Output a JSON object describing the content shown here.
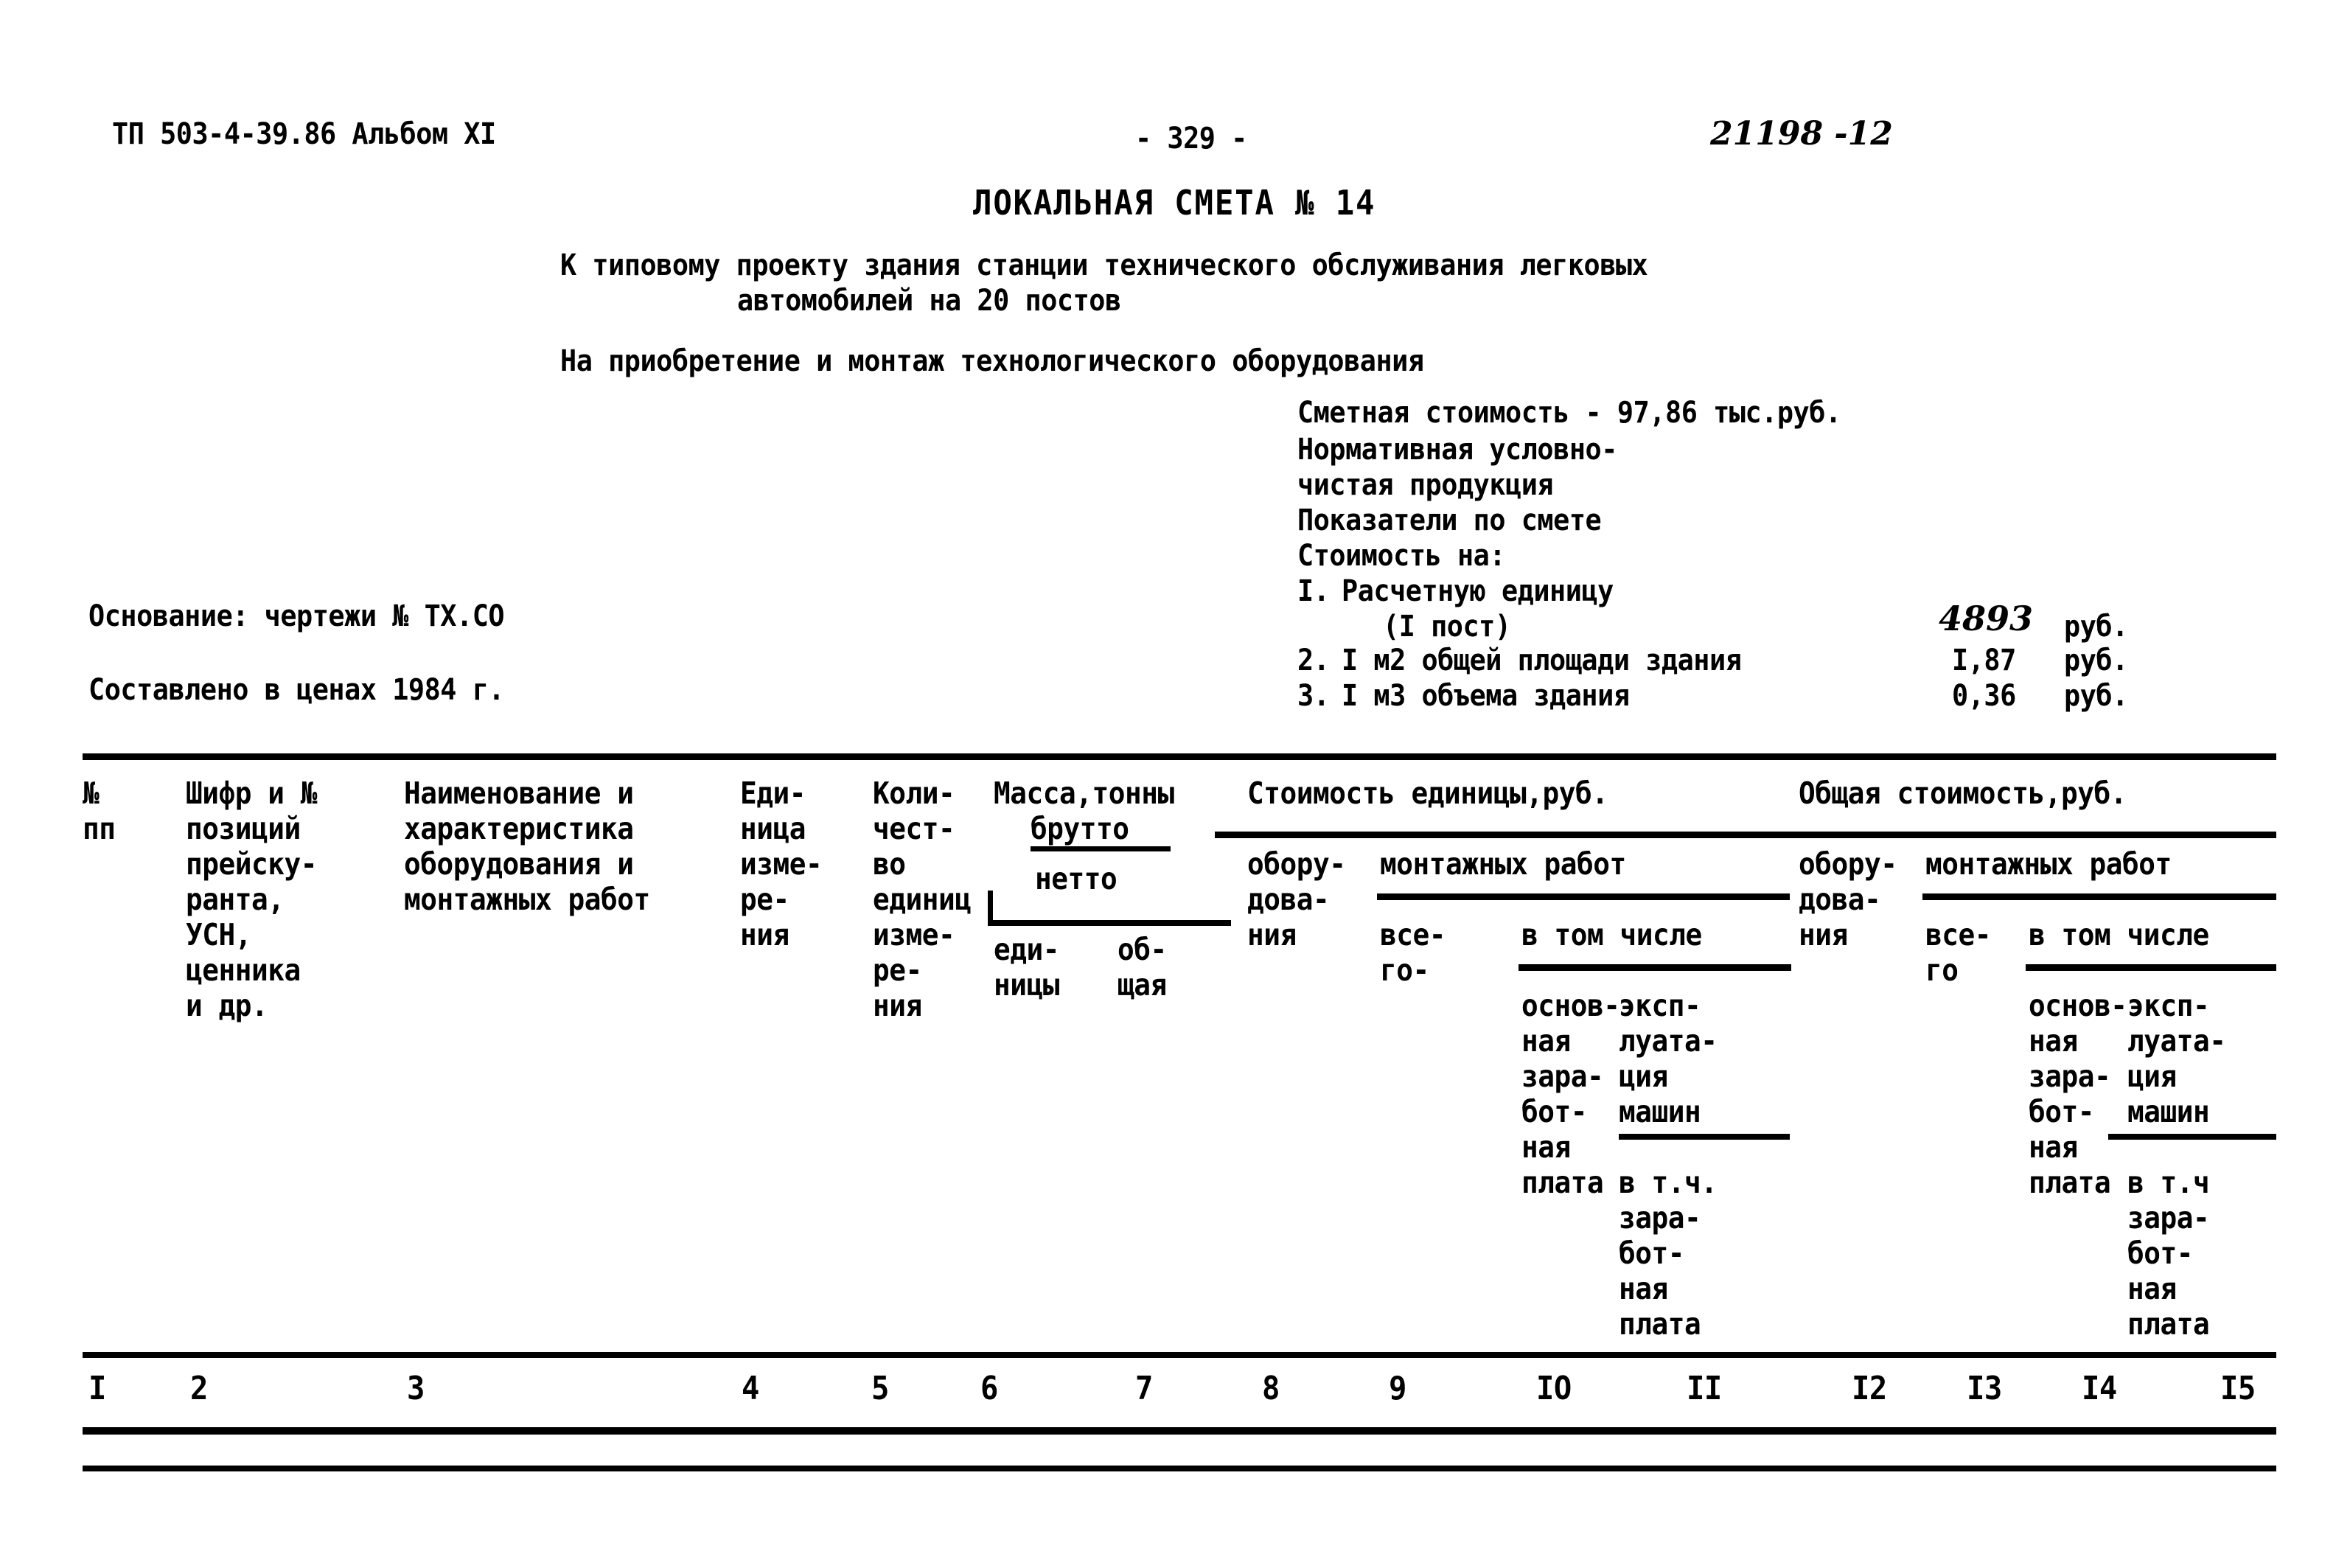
{
  "page": {
    "doc_code": "ТП 503-4-39.86 Альбом XI",
    "page_number": "- 329 -",
    "archive_stamp": "21198 -12"
  },
  "title": {
    "main": "ЛОКАЛЬНАЯ СМЕТА № 14",
    "subtitle_line1": "К типовому проекту здания станции технического обслуживания легковых",
    "subtitle_line2": "автомобилей на 20 постов",
    "purpose": "На приобретение и монтаж технологического оборудования"
  },
  "summary": {
    "estimate_cost": "Сметная стоимость - 97,86 тыс.руб.",
    "npp_line1": "Нормативная условно-",
    "npp_line2": "чистая продукция",
    "indicators_header": "Показатели по смете",
    "cost_for_label": "Стоимость на:",
    "items": [
      {
        "no": "I.",
        "label": "Расчетную единицу",
        "sub": "(I пост)",
        "value": "4893",
        "unit": "руб.",
        "handwritten": true
      },
      {
        "no": "2.",
        "label": "I м2 общей площади здания",
        "sub": "",
        "value": "I,87",
        "unit": "руб.",
        "handwritten": false
      },
      {
        "no": "3.",
        "label": "I м3 объема здания",
        "sub": "",
        "value": "0,36",
        "unit": "руб.",
        "handwritten": false
      }
    ]
  },
  "basis": {
    "basis_line": "Основание: чертежи № ТХ.СО",
    "prices_line": "Составлено в ценах 1984 г."
  },
  "table": {
    "col1": {
      "l1": "№",
      "l2": "пп"
    },
    "col2": {
      "l1": "Шифр и №",
      "l2": "позиций",
      "l3": "прейску-",
      "l4": "ранта,",
      "l5": "УСН,",
      "l6": "ценника",
      "l7": "и др."
    },
    "col3": {
      "l1": "Наименование и",
      "l2": "характеристика",
      "l3": "оборудования и",
      "l4": "монтажных работ"
    },
    "col4": {
      "l1": "Еди-",
      "l2": "ница",
      "l3": "изме-",
      "l4": "ре-",
      "l5": "ния"
    },
    "col5": {
      "l1": "Коли-",
      "l2": "чест-",
      "l3": "во",
      "l4": "единиц",
      "l5": "изме-",
      "l6": "ре-",
      "l7": "ния"
    },
    "mass_group": {
      "title": "Масса,тонны",
      "brutto": "брутто",
      "netto": "нетто"
    },
    "col6": {
      "l1": "еди-",
      "l2": "ницы"
    },
    "col7": {
      "l1": "об-",
      "l2": "щая"
    },
    "unit_cost_group": {
      "title": "Стоимость единицы,руб."
    },
    "total_cost_group": {
      "title": "Общая стоимость,руб."
    },
    "col8": {
      "l1": "обору-",
      "l2": "дова-",
      "l3": "ния"
    },
    "montage_left": {
      "title": "монтажных работ",
      "incl": "в том числе"
    },
    "col9": {
      "l1": "все-",
      "l2": "го-"
    },
    "col10": {
      "l1": "основ-",
      "l2": "ная",
      "l3": "зара-",
      "l4": "бот-",
      "l5": "ная",
      "l6": "плата"
    },
    "col11": {
      "l1": "эксп-",
      "l2": "луата-",
      "l3": "ция",
      "l4": "машин",
      "l5": "в т.ч.",
      "l6": "зара-",
      "l7": "бот-",
      "l8": "ная",
      "l9": "плата"
    },
    "col12": {
      "l1": "обору-",
      "l2": "дова-",
      "l3": "ния"
    },
    "montage_right": {
      "title": "монтажных работ",
      "incl": "в том числе"
    },
    "col13": {
      "l1": "все-",
      "l2": "го"
    },
    "col14": {
      "l1": "основ-",
      "l2": "ная",
      "l3": "зара-",
      "l4": "бот-",
      "l5": "ная",
      "l6": "плата"
    },
    "col15": {
      "l1": "эксп-",
      "l2": "луата-",
      "l3": "ция",
      "l4": "машин",
      "l5": "в т.ч",
      "l6": "зара-",
      "l7": "бот-",
      "l8": "ная",
      "l9": "плата"
    },
    "column_numbers": [
      "I",
      "2",
      "3",
      "4",
      "5",
      "6",
      "7",
      "8",
      "9",
      "IO",
      "II",
      "I2",
      "I3",
      "I4",
      "I5"
    ]
  }
}
